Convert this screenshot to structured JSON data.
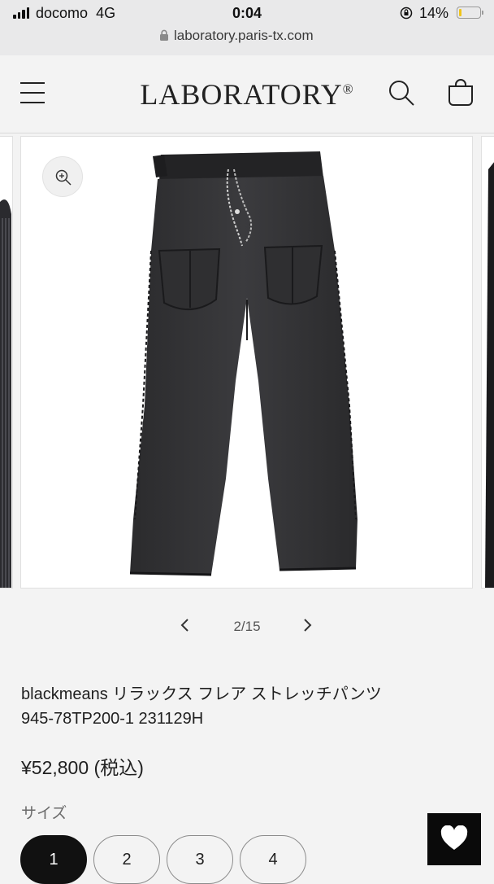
{
  "status_bar": {
    "carrier": "docomo",
    "network": "4G",
    "time": "0:04",
    "battery_percent": "14%",
    "battery_level": 0.14
  },
  "browser": {
    "url": "laboratory.paris-tx.com"
  },
  "header": {
    "logo": "LABORATORY",
    "logo_mark": "®",
    "icons": [
      "menu-icon",
      "search-icon",
      "cart-icon"
    ]
  },
  "gallery": {
    "counter": "2/15",
    "current": 2,
    "total": 15,
    "image_description_icon": "zoom-in-icon"
  },
  "product": {
    "title_line1": "blackmeans リラックス フレア ストレッチパンツ",
    "title_line2": "945-78TP200-1 231129H",
    "price": "¥52,800 (税込)"
  },
  "size_selector": {
    "label": "サイズ",
    "options": [
      "1",
      "2",
      "3",
      "4"
    ],
    "selected": "1"
  },
  "colors": {
    "background": "#f3f3f3",
    "selected_size": "#111111",
    "favorite_button": "#0a0a0a",
    "battery_fill": "#f0c419"
  }
}
